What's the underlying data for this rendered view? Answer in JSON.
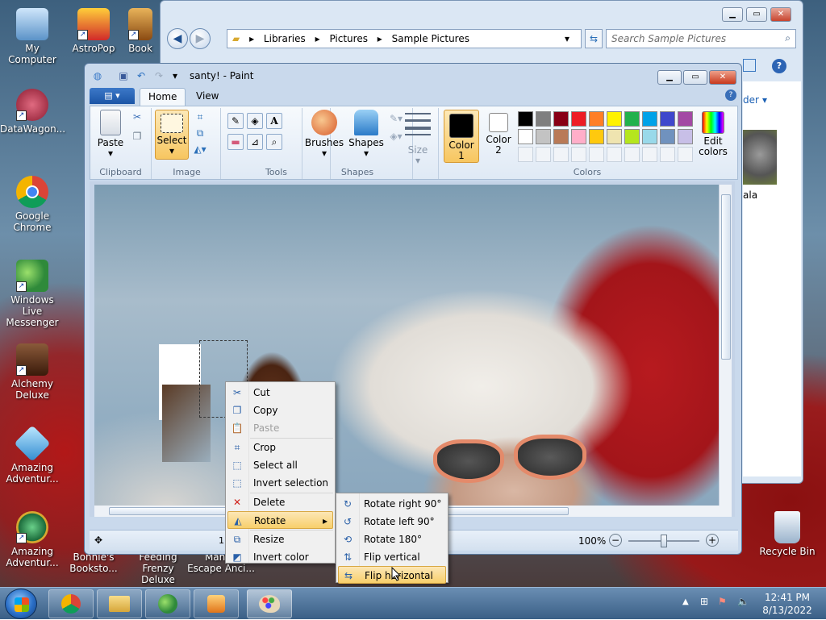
{
  "desktop": {
    "icons": [
      {
        "label": "My Computer",
        "icon": "computer-icon",
        "color": "#7fb3e0"
      },
      {
        "label": "AstroPop",
        "icon": "astropop-icon",
        "color": "#d12a2a"
      },
      {
        "label": "Book",
        "icon": "book-icon",
        "color": "#c47a1a"
      },
      {
        "label": "DataWagon...",
        "icon": "datawagon-icon",
        "color": "#b3203a"
      },
      {
        "label": "Google Chrome",
        "icon": "chrome-icon",
        "color": "#2f7de1"
      },
      {
        "label": "Windows Live Messenger",
        "icon": "messenger-icon",
        "color": "#4fa6e8"
      },
      {
        "label": "Alchemy Deluxe",
        "icon": "alchemy-icon",
        "color": "#6b3a1a"
      },
      {
        "label": "Amazing Adventur...",
        "icon": "amazing-icon",
        "color": "#3aa1d8"
      },
      {
        "label": "Amazing Adventur...",
        "icon": "amazing2-icon",
        "color": "#2a8f4a"
      },
      {
        "label": "Bonnie's Booksto...",
        "icon": "bonnie-icon",
        "color": "#9b5a2a"
      },
      {
        "label": "Feeding Frenzy Deluxe",
        "icon": "feeding-icon",
        "color": "#2a6fa8"
      },
      {
        "label": "Manj... Escape Anci...",
        "icon": "mahjong-icon",
        "color": "#a88a3a"
      },
      {
        "label": "Recycle Bin",
        "icon": "recycle-bin-icon",
        "color": "#c8d8e8"
      }
    ]
  },
  "explorer": {
    "breadcrumb": [
      "Libraries",
      "Pictures",
      "Sample Pictures"
    ],
    "search_placeholder": "Search Sample Pictures",
    "partial_label_right": "der",
    "partial_thumb_label": "ala"
  },
  "paint": {
    "title": "santy! - Paint",
    "file_tab": "▤ ▾",
    "tabs": [
      "Home",
      "View"
    ],
    "groups": {
      "clipboard": {
        "label": "Clipboard",
        "paste": "Paste"
      },
      "image": {
        "label": "Image",
        "select": "Select"
      },
      "tools": {
        "label": "Tools"
      },
      "shapes": {
        "label": "Shapes",
        "brushes": "Brushes",
        "shapes": "Shapes"
      },
      "size": {
        "label": "Size"
      },
      "colors": {
        "label": "Colors",
        "color1": "Color\n1",
        "color2": "Color\n2",
        "edit": "Edit\ncolors"
      }
    },
    "palette_row1": [
      "#000000",
      "#7f7f7f",
      "#880015",
      "#ed1c24",
      "#ff7f27",
      "#fff200",
      "#22b14c",
      "#00a2e8",
      "#3f48cc",
      "#a349a4"
    ],
    "palette_row2": [
      "#ffffff",
      "#c3c3c3",
      "#b97a57",
      "#ffaec9",
      "#ffc90e",
      "#efe4b0",
      "#b5e61d",
      "#99d9ea",
      "#7092be",
      "#c8bfe7"
    ],
    "color1": "#000000",
    "color2": "#ffffff",
    "status": {
      "zoom": "100%",
      "left_partial": "1"
    }
  },
  "context_menu": {
    "items": [
      {
        "label": "Cut",
        "icon": "scissors-icon",
        "glyph": "✂"
      },
      {
        "label": "Copy",
        "icon": "copy-icon",
        "glyph": "❐"
      },
      {
        "label": "Paste",
        "icon": "paste-icon",
        "glyph": "📋",
        "disabled": true
      },
      {
        "label": "Crop",
        "icon": "crop-icon",
        "glyph": "⌗"
      },
      {
        "label": "Select all",
        "icon": "select-all-icon",
        "glyph": "⬚"
      },
      {
        "label": "Invert selection",
        "icon": "invert-selection-icon",
        "glyph": "⬚"
      },
      {
        "label": "Delete",
        "icon": "delete-icon",
        "glyph": "✕"
      },
      {
        "label": "Rotate",
        "icon": "rotate-icon",
        "glyph": "◭",
        "submenu": true
      },
      {
        "label": "Resize",
        "icon": "resize-icon",
        "glyph": "⧉"
      },
      {
        "label": "Invert color",
        "icon": "invert-color-icon",
        "glyph": "◩"
      }
    ]
  },
  "rotate_submenu": {
    "items": [
      {
        "label": "Rotate right 90°",
        "icon": "rotate-right-icon",
        "glyph": "↻"
      },
      {
        "label": "Rotate left 90°",
        "icon": "rotate-left-icon",
        "glyph": "↺"
      },
      {
        "label": "Rotate 180°",
        "icon": "rotate-180-icon",
        "glyph": "⟲"
      },
      {
        "label": "Flip vertical",
        "icon": "flip-vertical-icon",
        "glyph": "⇅"
      },
      {
        "label": "Flip horizontal",
        "icon": "flip-horizontal-icon",
        "glyph": "⇆"
      }
    ]
  },
  "taskbar": {
    "clock_time": "12:41 PM",
    "clock_date": "8/13/2022"
  }
}
